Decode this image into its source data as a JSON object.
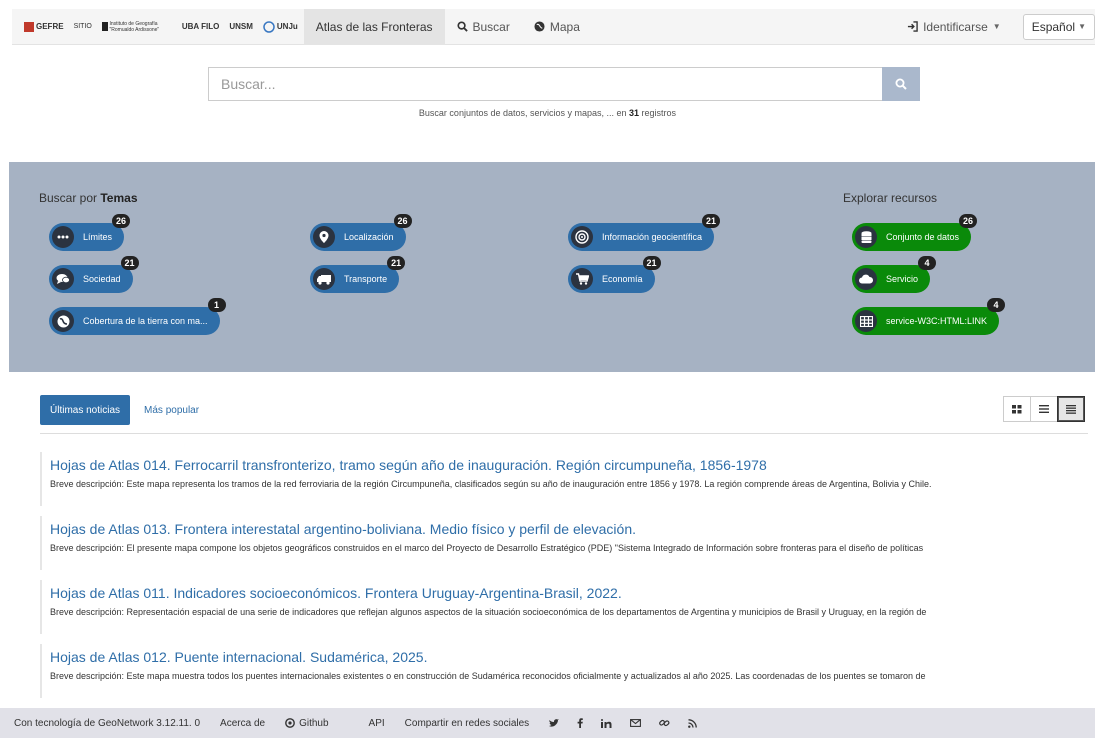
{
  "navbar": {
    "logos": [
      {
        "name": "gefre-logo",
        "text": "GEFRE"
      },
      {
        "name": "sitio-logo",
        "text": "SITIO"
      },
      {
        "name": "instituto-geografia-logo",
        "text": "Instituto de Geografía \"Romualdo Ardissone\""
      },
      {
        "name": "uba-filo-logo",
        "text": "UBA FILO"
      },
      {
        "name": "unsm-logo",
        "text": "UNSM"
      },
      {
        "name": "unju-logo",
        "text": "UNJu"
      }
    ],
    "brand": "Atlas de las Fronteras",
    "search_label": "Buscar",
    "map_label": "Mapa",
    "login_label": "Identificarse",
    "language_label": "Español"
  },
  "search": {
    "placeholder": "Buscar...",
    "hint_prefix": "Buscar conjuntos de datos, servicios y mapas, ... en ",
    "hint_count": "31",
    "hint_suffix": " registros"
  },
  "themes": {
    "title_prefix": "Buscar por ",
    "title_bold": "Temas",
    "items": [
      {
        "label": "Límites",
        "count": "26",
        "icon": "dots-icon"
      },
      {
        "label": "Localización",
        "count": "26",
        "icon": "map-pin-icon"
      },
      {
        "label": "Información geocientífica",
        "count": "21",
        "icon": "target-icon"
      },
      {
        "label": "Sociedad",
        "count": "21",
        "icon": "chat-bubbles-icon"
      },
      {
        "label": "Transporte",
        "count": "21",
        "icon": "truck-icon"
      },
      {
        "label": "Economía",
        "count": "21",
        "icon": "cart-icon"
      },
      {
        "label": "Cobertura de la tierra con ma...",
        "count": "1",
        "icon": "globe-icon"
      }
    ]
  },
  "resources": {
    "title": "Explorar recursos",
    "items": [
      {
        "label": "Conjunto de datos",
        "count": "26",
        "icon": "database-icon"
      },
      {
        "label": "Servicio",
        "count": "4",
        "icon": "cloud-icon"
      },
      {
        "label": "service-W3C:HTML:LINK",
        "count": "4",
        "icon": "table-icon"
      }
    ]
  },
  "tabs": {
    "latest": "Últimas noticias",
    "popular": "Más popular"
  },
  "news": [
    {
      "title": "Hojas de Atlas 014. Ferrocarril transfronterizo, tramo según año de inauguración. Región circumpuneña, 1856-1978",
      "desc": "Breve descripción: Este mapa representa los tramos de la red ferroviaria de la región Circumpuneña, clasificados según su año de inauguración entre 1856 y 1978. La región comprende áreas de Argentina, Bolivia y Chile."
    },
    {
      "title": "Hojas de Atlas 013. Frontera interestatal argentino-boliviana. Medio físico y perfil de elevación.",
      "desc": "Breve descripción: El presente mapa compone los objetos geográficos construidos en el marco del Proyecto de Desarrollo Estratégico (PDE) \"Sistema Integrado de Información sobre fronteras para el diseño de políticas"
    },
    {
      "title": "Hojas de Atlas 011. Indicadores socioeconómicos. Frontera Uruguay-Argentina-Brasil, 2022.",
      "desc": "Breve descripción: Representación espacial de una serie de indicadores que reflejan algunos aspectos de la situación socioeconómica de los departamentos de Argentina y municipios de Brasil y Uruguay, en la región de"
    },
    {
      "title": "Hojas de Atlas 012. Puente internacional. Sudamérica, 2025.",
      "desc": "Breve descripción: Este mapa muestra todos los puentes internacionales existentes o en construcción de Sudamérica reconocidos oficialmente y actualizados al año 2025. Las coordenadas de los puentes se tomaron de"
    }
  ],
  "footer": {
    "powered": "Con tecnología de GeoNetwork 3.12.11. 0",
    "about": "Acerca de",
    "github": "Github",
    "api": "API",
    "share": "Compartir en redes sociales"
  },
  "colors": {
    "band": "#a6b2c3",
    "theme_pill": "#2f6ea8",
    "resource_pill": "#0a8a0a",
    "link": "#2f6ea8"
  }
}
